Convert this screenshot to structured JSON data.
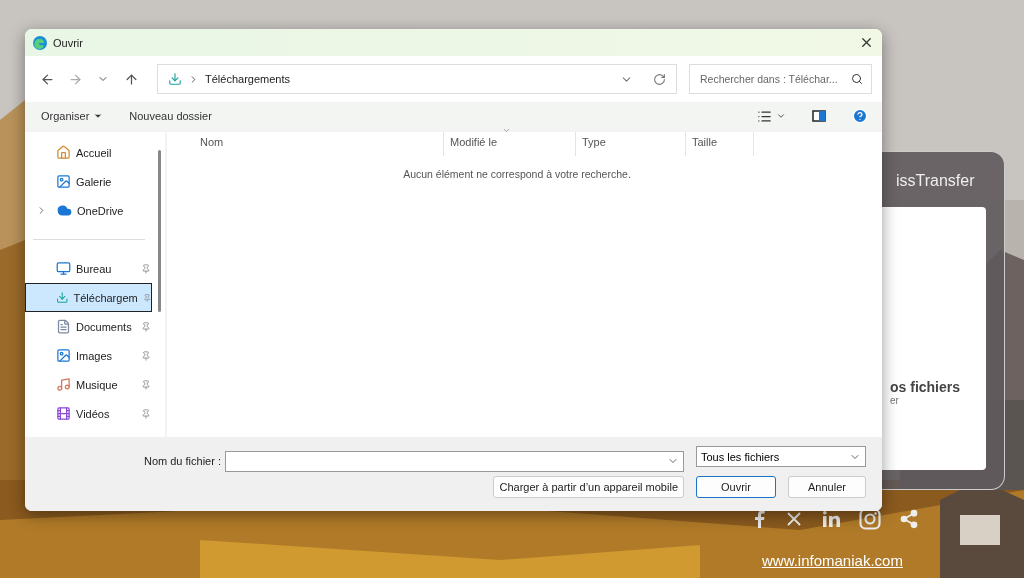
{
  "window": {
    "title": "Ouvrir"
  },
  "address": {
    "path": "Téléchargements"
  },
  "search": {
    "placeholder": "Rechercher dans : Téléchar..."
  },
  "toolbar": {
    "organize": "Organiser",
    "new_folder": "Nouveau dossier"
  },
  "sidebar": {
    "top_items": [
      {
        "label": "Accueil",
        "expandable": false,
        "pinned": false,
        "selected": false
      },
      {
        "label": "Galerie",
        "expandable": false,
        "pinned": false,
        "selected": false
      },
      {
        "label": "OneDrive",
        "expandable": true,
        "pinned": false,
        "selected": false
      }
    ],
    "pinned_items": [
      {
        "label": "Bureau",
        "expandable": false,
        "pinned": true,
        "selected": false
      },
      {
        "label": "Téléchargem",
        "expandable": false,
        "pinned": true,
        "selected": true
      },
      {
        "label": "Documents",
        "expandable": false,
        "pinned": true,
        "selected": false
      },
      {
        "label": "Images",
        "expandable": false,
        "pinned": true,
        "selected": false
      },
      {
        "label": "Musique",
        "expandable": false,
        "pinned": true,
        "selected": false
      },
      {
        "label": "Vidéos",
        "expandable": false,
        "pinned": true,
        "selected": false
      }
    ]
  },
  "table": {
    "columns": [
      {
        "label": "Nom",
        "sorted": false
      },
      {
        "label": "Modifié le",
        "sorted": true
      },
      {
        "label": "Type",
        "sorted": false
      },
      {
        "label": "Taille",
        "sorted": false
      }
    ],
    "empty_message": "Aucun élément ne correspond à votre recherche."
  },
  "footer": {
    "filename_label": "Nom du fichier :",
    "file_type": "Tous les fichiers",
    "buttons": [
      {
        "label": "Charger à partir d’un appareil mobile",
        "kind": "secondary"
      },
      {
        "label": "Ouvrir",
        "kind": "primary"
      },
      {
        "label": "Annuler",
        "kind": "secondary"
      }
    ]
  },
  "background_page": {
    "card_title": "issTransfer",
    "card_heading": "os fichiers",
    "card_subtext": "er",
    "link": "www.infomaniak.com"
  }
}
